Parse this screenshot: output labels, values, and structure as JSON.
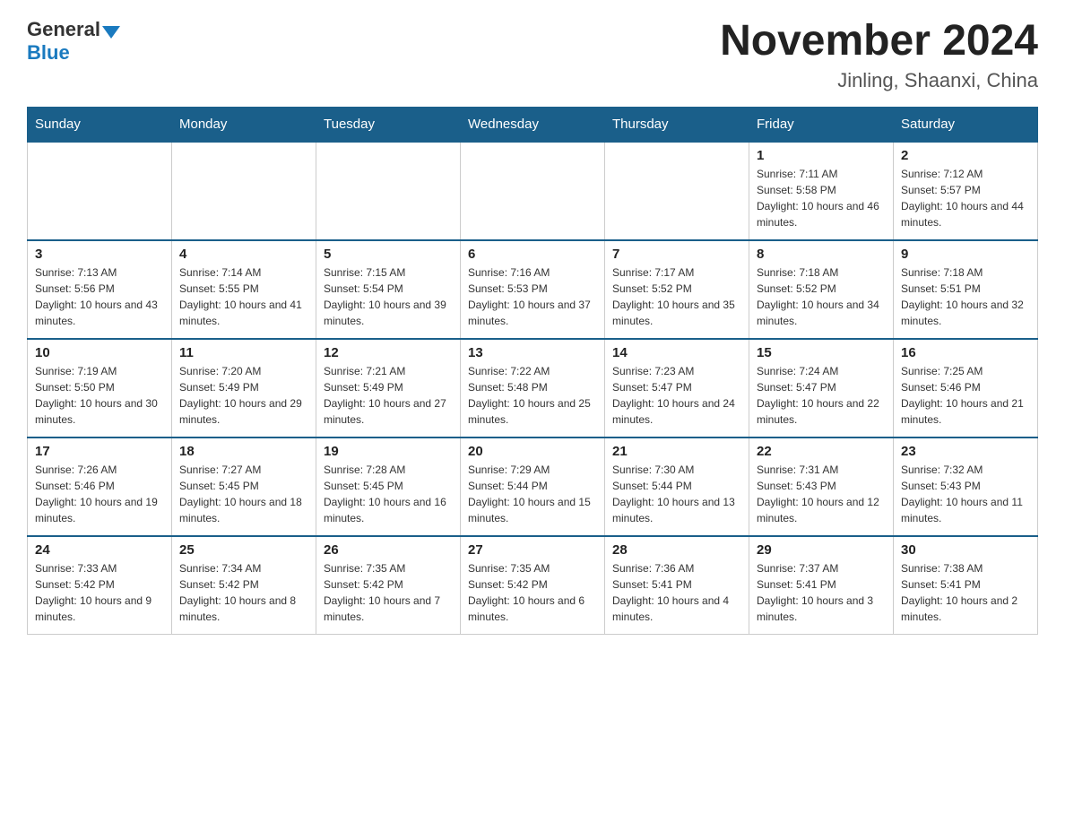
{
  "header": {
    "logo_general": "General",
    "logo_blue": "Blue",
    "month_title": "November 2024",
    "location": "Jinling, Shaanxi, China"
  },
  "weekdays": [
    "Sunday",
    "Monday",
    "Tuesday",
    "Wednesday",
    "Thursday",
    "Friday",
    "Saturday"
  ],
  "weeks": [
    [
      {
        "day": "",
        "sunrise": "",
        "sunset": "",
        "daylight": ""
      },
      {
        "day": "",
        "sunrise": "",
        "sunset": "",
        "daylight": ""
      },
      {
        "day": "",
        "sunrise": "",
        "sunset": "",
        "daylight": ""
      },
      {
        "day": "",
        "sunrise": "",
        "sunset": "",
        "daylight": ""
      },
      {
        "day": "",
        "sunrise": "",
        "sunset": "",
        "daylight": ""
      },
      {
        "day": "1",
        "sunrise": "7:11 AM",
        "sunset": "5:58 PM",
        "daylight": "10 hours and 46 minutes."
      },
      {
        "day": "2",
        "sunrise": "7:12 AM",
        "sunset": "5:57 PM",
        "daylight": "10 hours and 44 minutes."
      }
    ],
    [
      {
        "day": "3",
        "sunrise": "7:13 AM",
        "sunset": "5:56 PM",
        "daylight": "10 hours and 43 minutes."
      },
      {
        "day": "4",
        "sunrise": "7:14 AM",
        "sunset": "5:55 PM",
        "daylight": "10 hours and 41 minutes."
      },
      {
        "day": "5",
        "sunrise": "7:15 AM",
        "sunset": "5:54 PM",
        "daylight": "10 hours and 39 minutes."
      },
      {
        "day": "6",
        "sunrise": "7:16 AM",
        "sunset": "5:53 PM",
        "daylight": "10 hours and 37 minutes."
      },
      {
        "day": "7",
        "sunrise": "7:17 AM",
        "sunset": "5:52 PM",
        "daylight": "10 hours and 35 minutes."
      },
      {
        "day": "8",
        "sunrise": "7:18 AM",
        "sunset": "5:52 PM",
        "daylight": "10 hours and 34 minutes."
      },
      {
        "day": "9",
        "sunrise": "7:18 AM",
        "sunset": "5:51 PM",
        "daylight": "10 hours and 32 minutes."
      }
    ],
    [
      {
        "day": "10",
        "sunrise": "7:19 AM",
        "sunset": "5:50 PM",
        "daylight": "10 hours and 30 minutes."
      },
      {
        "day": "11",
        "sunrise": "7:20 AM",
        "sunset": "5:49 PM",
        "daylight": "10 hours and 29 minutes."
      },
      {
        "day": "12",
        "sunrise": "7:21 AM",
        "sunset": "5:49 PM",
        "daylight": "10 hours and 27 minutes."
      },
      {
        "day": "13",
        "sunrise": "7:22 AM",
        "sunset": "5:48 PM",
        "daylight": "10 hours and 25 minutes."
      },
      {
        "day": "14",
        "sunrise": "7:23 AM",
        "sunset": "5:47 PM",
        "daylight": "10 hours and 24 minutes."
      },
      {
        "day": "15",
        "sunrise": "7:24 AM",
        "sunset": "5:47 PM",
        "daylight": "10 hours and 22 minutes."
      },
      {
        "day": "16",
        "sunrise": "7:25 AM",
        "sunset": "5:46 PM",
        "daylight": "10 hours and 21 minutes."
      }
    ],
    [
      {
        "day": "17",
        "sunrise": "7:26 AM",
        "sunset": "5:46 PM",
        "daylight": "10 hours and 19 minutes."
      },
      {
        "day": "18",
        "sunrise": "7:27 AM",
        "sunset": "5:45 PM",
        "daylight": "10 hours and 18 minutes."
      },
      {
        "day": "19",
        "sunrise": "7:28 AM",
        "sunset": "5:45 PM",
        "daylight": "10 hours and 16 minutes."
      },
      {
        "day": "20",
        "sunrise": "7:29 AM",
        "sunset": "5:44 PM",
        "daylight": "10 hours and 15 minutes."
      },
      {
        "day": "21",
        "sunrise": "7:30 AM",
        "sunset": "5:44 PM",
        "daylight": "10 hours and 13 minutes."
      },
      {
        "day": "22",
        "sunrise": "7:31 AM",
        "sunset": "5:43 PM",
        "daylight": "10 hours and 12 minutes."
      },
      {
        "day": "23",
        "sunrise": "7:32 AM",
        "sunset": "5:43 PM",
        "daylight": "10 hours and 11 minutes."
      }
    ],
    [
      {
        "day": "24",
        "sunrise": "7:33 AM",
        "sunset": "5:42 PM",
        "daylight": "10 hours and 9 minutes."
      },
      {
        "day": "25",
        "sunrise": "7:34 AM",
        "sunset": "5:42 PM",
        "daylight": "10 hours and 8 minutes."
      },
      {
        "day": "26",
        "sunrise": "7:35 AM",
        "sunset": "5:42 PM",
        "daylight": "10 hours and 7 minutes."
      },
      {
        "day": "27",
        "sunrise": "7:35 AM",
        "sunset": "5:42 PM",
        "daylight": "10 hours and 6 minutes."
      },
      {
        "day": "28",
        "sunrise": "7:36 AM",
        "sunset": "5:41 PM",
        "daylight": "10 hours and 4 minutes."
      },
      {
        "day": "29",
        "sunrise": "7:37 AM",
        "sunset": "5:41 PM",
        "daylight": "10 hours and 3 minutes."
      },
      {
        "day": "30",
        "sunrise": "7:38 AM",
        "sunset": "5:41 PM",
        "daylight": "10 hours and 2 minutes."
      }
    ]
  ]
}
